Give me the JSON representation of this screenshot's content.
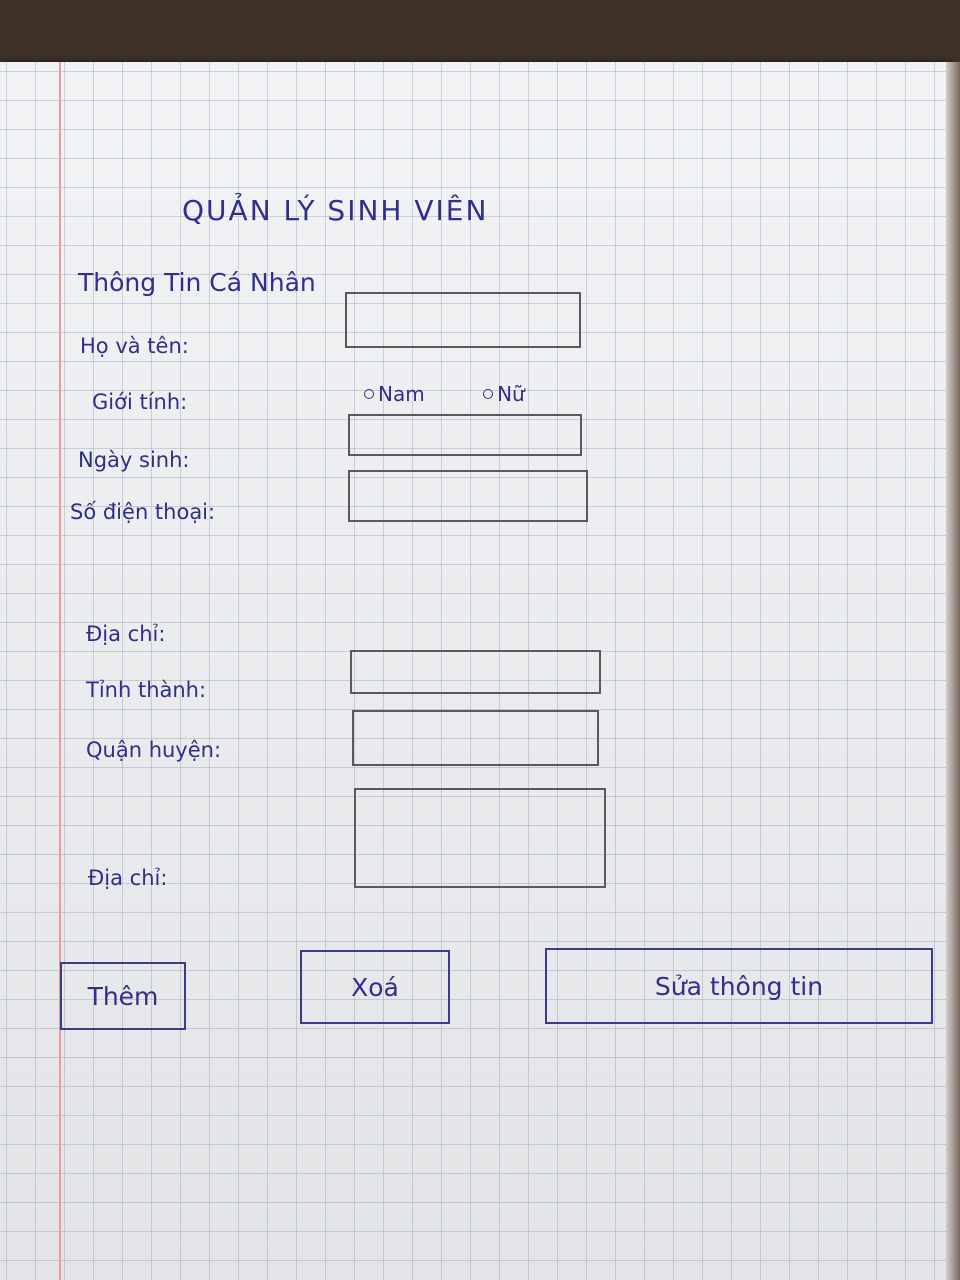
{
  "form": {
    "title": "QUẢN LÝ SINH VIÊN",
    "section_title": "Thông Tin Cá Nhân",
    "labels": {
      "full_name": "Họ và tên:",
      "gender": "Giới tính:",
      "birth_date": "Ngày sinh:",
      "phone": "Số điện thoại:",
      "address_group": "Địa chỉ:",
      "province": "Tỉnh thành:",
      "district": "Quận huyện:",
      "address": "Địa chỉ:"
    },
    "gender_options": [
      "Nam",
      "Nữ"
    ],
    "buttons": {
      "add": "Thêm",
      "delete": "Xoá",
      "edit": "Sửa thông tin"
    }
  },
  "colors": {
    "ink": "#2e2f8e",
    "paper": "#ebecee",
    "margin_line": "#e79aa2"
  }
}
